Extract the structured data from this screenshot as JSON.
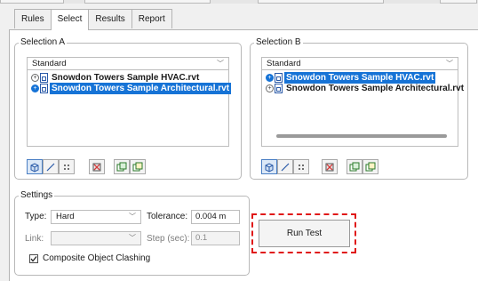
{
  "tabs": [
    {
      "label": "Rules"
    },
    {
      "label": "Select"
    },
    {
      "label": "Results"
    },
    {
      "label": "Report"
    }
  ],
  "active_tab": "Select",
  "selection_a": {
    "legend": "Selection A",
    "dropdown_value": "Standard",
    "items": [
      {
        "label": "Snowdon Towers Sample HVAC.rvt",
        "selected": false
      },
      {
        "label": "Snowdon Towers Sample Architectural.rvt",
        "selected": true
      }
    ]
  },
  "selection_b": {
    "legend": "Selection B",
    "dropdown_value": "Standard",
    "items": [
      {
        "label": "Snowdon Towers Sample HVAC.rvt",
        "selected": true
      },
      {
        "label": "Snowdon Towers Sample Architectural.rvt",
        "selected": false
      }
    ]
  },
  "toolbar_icons": [
    "surfaces-icon",
    "lines-icon",
    "points-icon",
    "self-intersect-icon",
    "use-current-selection-icon",
    "select-in-scene-icon"
  ],
  "settings": {
    "legend": "Settings",
    "type_label": "Type:",
    "type_value": "Hard",
    "tolerance_label": "Tolerance:",
    "tolerance_value": "0.004 m",
    "link_label": "Link:",
    "link_value": "",
    "step_label": "Step (sec):",
    "step_value": "0.1",
    "composite_label": "Composite Object Clashing",
    "composite_checked": true
  },
  "run_test": {
    "label": "Run Test"
  },
  "colors": {
    "selection_blue": "#1673d6",
    "highlight_red": "#e01818"
  }
}
